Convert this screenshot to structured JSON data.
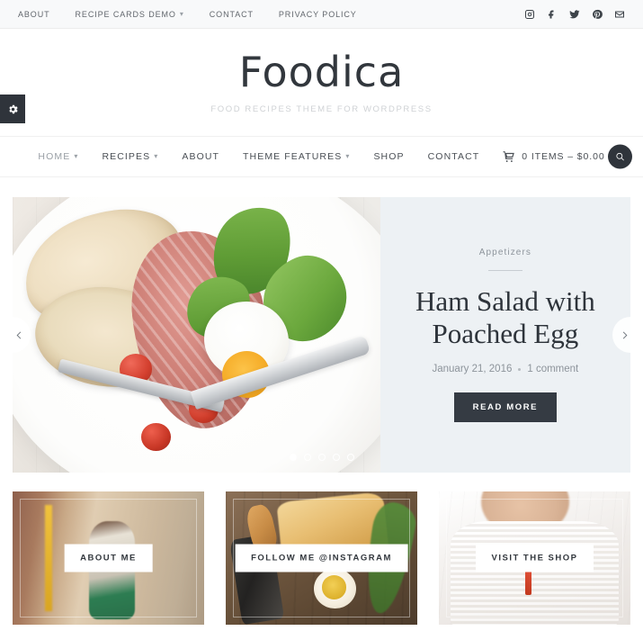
{
  "topbar": {
    "nav": [
      {
        "label": "ABOUT",
        "has_caret": false
      },
      {
        "label": "RECIPE CARDS DEMO",
        "has_caret": true
      },
      {
        "label": "CONTACT",
        "has_caret": false
      },
      {
        "label": "PRIVACY POLICY",
        "has_caret": false
      }
    ],
    "social": [
      {
        "name": "instagram-icon"
      },
      {
        "name": "facebook-icon"
      },
      {
        "name": "twitter-icon"
      },
      {
        "name": "pinterest-icon"
      },
      {
        "name": "email-icon"
      }
    ]
  },
  "branding": {
    "logo": "Foodica",
    "tagline": "FOOD RECIPES THEME FOR WORDPRESS"
  },
  "mainnav": {
    "items": [
      {
        "label": "HOME",
        "has_caret": true,
        "active": true
      },
      {
        "label": "RECIPES",
        "has_caret": true,
        "active": false
      },
      {
        "label": "ABOUT",
        "has_caret": false,
        "active": false
      },
      {
        "label": "THEME FEATURES",
        "has_caret": true,
        "active": false
      },
      {
        "label": "SHOP",
        "has_caret": false,
        "active": false
      },
      {
        "label": "CONTACT",
        "has_caret": false,
        "active": false
      }
    ],
    "cart_label": "0 ITEMS – $0.00",
    "search_icon": "search-icon"
  },
  "gear_tab": {
    "icon": "gear-icon"
  },
  "hero": {
    "category": "Appetizers",
    "title": "Ham Salad with Poached Egg",
    "date": "January 21, 2016",
    "comments": "1 comment",
    "button": "READ MORE",
    "prev_icon": "chevron-left-icon",
    "next_icon": "chevron-right-icon",
    "dots_total": 5,
    "dot_active": 1,
    "bg_color": "#edf1f4"
  },
  "promos": [
    {
      "label": "ABOUT ME"
    },
    {
      "label": "FOLLOW ME @INSTAGRAM"
    },
    {
      "label": "VISIT THE SHOP"
    }
  ],
  "colors": {
    "dark": "#2f343b",
    "button_dark": "#353b43",
    "topbar_bg": "#f8f9fa",
    "hero_bg": "#edf1f4",
    "muted_text": "#8e959c"
  }
}
